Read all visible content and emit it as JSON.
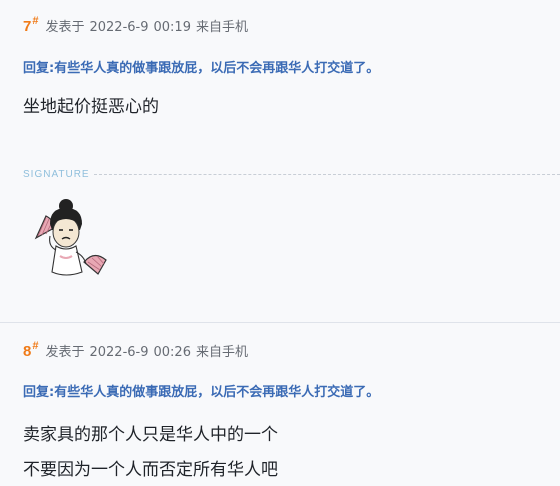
{
  "posts": [
    {
      "floor": "7",
      "hash": "#",
      "meta_prefix": "发表于",
      "date": "2022-6-9",
      "time": "00:19",
      "source": "来自手机",
      "reply_label": "回复:",
      "reply_title": "有些华人真的做事跟放屁，以后不会再跟华人打交道了。",
      "content": [
        "坐地起价挺恶心的"
      ],
      "signature_label": "SIGNATURE",
      "sticker_icon": "cartoon-girl-with-fans-sticker"
    },
    {
      "floor": "8",
      "hash": "#",
      "meta_prefix": "发表于",
      "date": "2022-6-9",
      "time": "00:26",
      "source": "来自手机",
      "reply_label": "回复:",
      "reply_title": "有些华人真的做事跟放屁，以后不会再跟华人打交道了。",
      "content": [
        "卖家具的那个人只是华人中的一个",
        "不要因为一个人而否定所有华人吧"
      ]
    }
  ],
  "colors": {
    "floor": "#f07b18",
    "reply": "#3b6bb5",
    "signature": "#8fbfdc",
    "background": "#f8f9fb"
  }
}
